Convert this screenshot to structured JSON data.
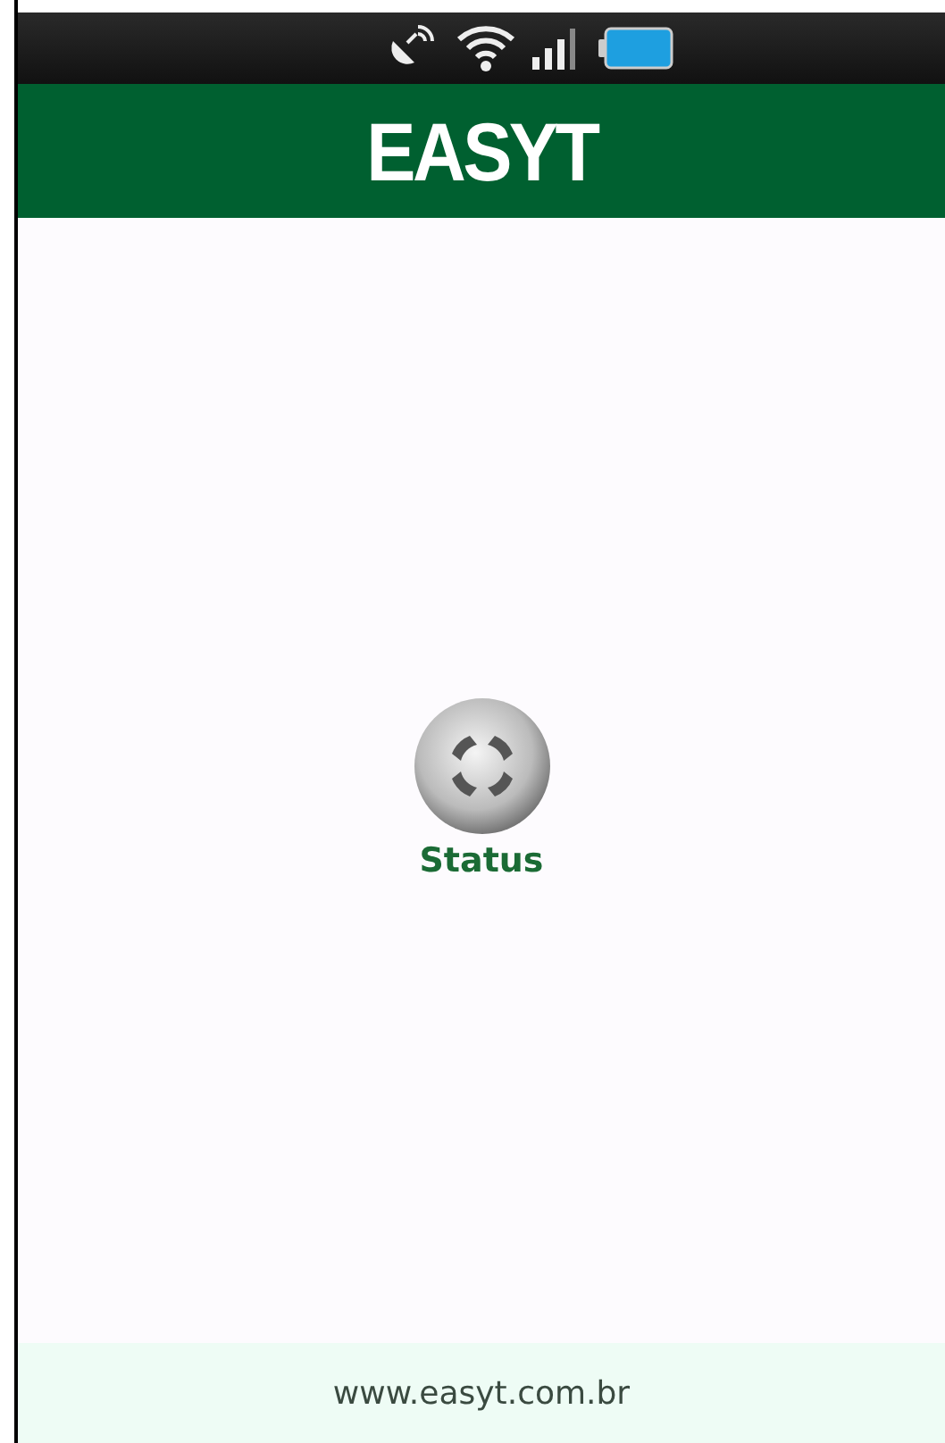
{
  "header": {
    "logo": "EASYT"
  },
  "menu": [
    {
      "label": "Status"
    }
  ],
  "footer": {
    "text": "www.easyt.com.br"
  }
}
